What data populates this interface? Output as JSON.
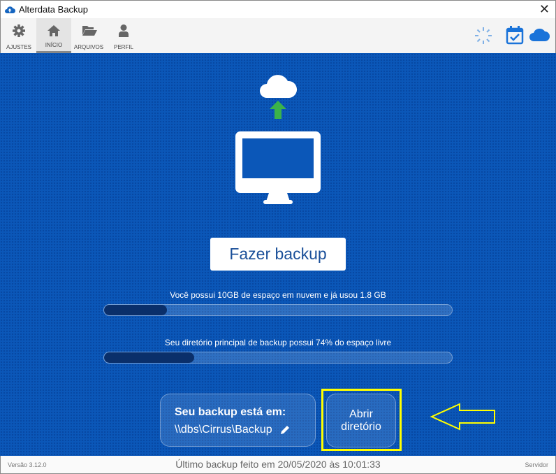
{
  "window": {
    "title": "Alterdata Backup",
    "close_label": "✕"
  },
  "toolbar": {
    "items": [
      {
        "label": "AJUSTES"
      },
      {
        "label": "INÍCIO"
      },
      {
        "label": "ARQUIVOS"
      },
      {
        "label": "PERFIL"
      }
    ]
  },
  "main": {
    "backup_button": "Fazer backup",
    "cloud_usage": {
      "text": "Você possui 10GB de espaço em nuvem e já usou 1.8 GB",
      "percent": 18
    },
    "disk_usage": {
      "text": "Seu diretório principal de backup possui 74% do espaço livre",
      "used_percent": 26
    },
    "location": {
      "title": "Seu backup está em:",
      "path": "\\\\dbs\\Cirrus\\Backup"
    },
    "open_dir_button": "Abrir diretório"
  },
  "footer": {
    "version": "Versão 3.12.0",
    "last_backup": "Último backup feito em 20/05/2020 às 10:01:33",
    "mode": "Servidor"
  },
  "colors": {
    "background": "#0b57b8",
    "accent": "#1a73d9",
    "highlight": "#ffff00",
    "arrow_green": "#3bb34a"
  }
}
